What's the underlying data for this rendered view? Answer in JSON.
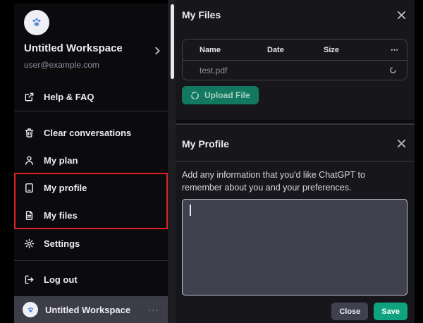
{
  "sidebar": {
    "workspace_name": "Untitled Workspace",
    "email": "user@example.com",
    "help": {
      "label": "Help & FAQ",
      "icon": "external-link-icon"
    },
    "items": [
      {
        "label": "Clear conversations",
        "icon": "trash-icon",
        "highlighted": false
      },
      {
        "label": "My plan",
        "icon": "user-icon",
        "highlighted": false
      },
      {
        "label": "My profile",
        "icon": "profile-card-icon",
        "highlighted": true
      },
      {
        "label": "My files",
        "icon": "file-icon",
        "highlighted": true
      },
      {
        "label": "Settings",
        "icon": "gear-icon",
        "highlighted": false
      },
      {
        "label": "Log out",
        "icon": "logout-icon",
        "highlighted": false
      }
    ],
    "footer": {
      "workspace_name": "Untitled Workspace",
      "menu_glyph": "···",
      "menu_icon": "ellipsis-icon"
    }
  },
  "files_panel": {
    "title": "My Files",
    "close_icon": "x-icon",
    "table": {
      "columns": [
        "Name",
        "Date",
        "Size",
        "⋯"
      ],
      "rows": [
        {
          "name": "test.pdf",
          "date": "",
          "size": "",
          "action_icon": "spinner-icon"
        }
      ]
    },
    "upload_button": {
      "label": "Upload File",
      "icon": "spinner-icon",
      "state": "loading"
    }
  },
  "profile_panel": {
    "title": "My Profile",
    "close_icon": "x-icon",
    "description": "Add any information that you'd like ChatGPT to remember about you and your preferences.",
    "textarea": {
      "value": "",
      "placeholder": ""
    },
    "buttons": {
      "close": "Close",
      "save": "Save"
    }
  },
  "colors": {
    "accent_green": "#10a37f",
    "upload_button_green": "#127960",
    "highlight_red": "#dd2222",
    "sidebar_bg": "#0b0b0e",
    "panel_bg": "#17171b",
    "textarea_bg": "#40414f",
    "footer_bar_bg": "#3c3d49"
  }
}
